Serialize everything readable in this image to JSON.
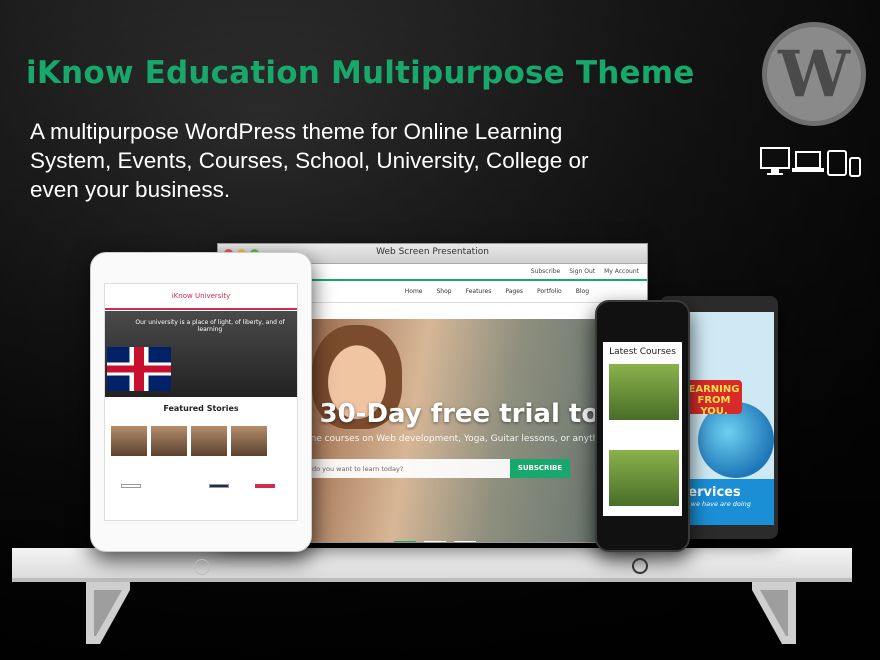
{
  "header": {
    "title": "iKnow Education Multipurpose Theme",
    "subtitle_lines": [
      "A multipurpose WordPress theme for Online Learning",
      "System, Events, Courses, School, University, College or",
      "even your business."
    ]
  },
  "icons": {
    "wordpress": "wordpress-logo-icon",
    "devices": "responsive-devices-icon"
  },
  "browser": {
    "window_title": "Web Screen Presentation",
    "top_links": [
      "Subscribe",
      "Sign Out",
      "My Account"
    ],
    "nav": [
      "Home",
      "Shop",
      "Features",
      "Pages",
      "Portfolio",
      "Blog"
    ],
    "hero_heading": "t 30-Day free trial today",
    "hero_text": "ine courses on Web development, Yoga, Guitar lessons, or anythin",
    "search_placeholder": "do you want to learn today?",
    "subscribe_label": "SUBSCRIBE"
  },
  "left_tablet": {
    "header": "iKnow University",
    "hero_line": "Our university is a place of light, of liberty, and of learning",
    "featured": "Featured Stories"
  },
  "phone": {
    "heading": "Latest Courses"
  },
  "right_tablet": {
    "badge": "EARNING FROM YOU.",
    "band_title": "r Services",
    "band_sub": "t what we have are doing"
  },
  "colors": {
    "accent_green": "#18a86b",
    "brand_red": "#d02c4c",
    "service_blue": "#1a8fd6"
  }
}
